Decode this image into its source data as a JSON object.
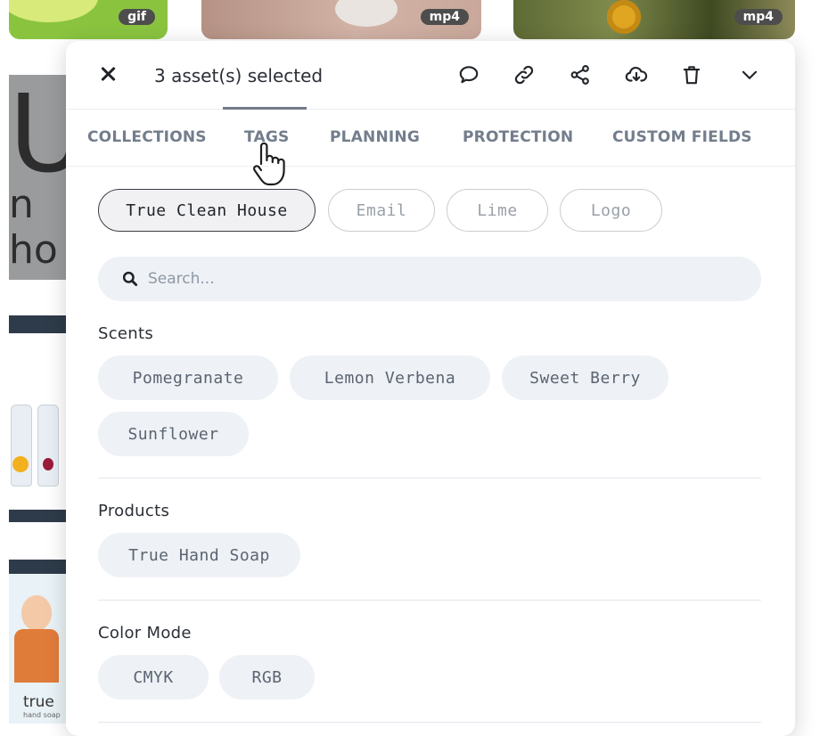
{
  "background": {
    "thumbnails": [
      {
        "format": "gif"
      },
      {
        "format": "mp4"
      },
      {
        "format": "mp4"
      }
    ],
    "grey_letter": "U",
    "grey_fragment": "n ho",
    "product_brand": "true",
    "product_sub": "hand soap"
  },
  "panel": {
    "selection_label": "3 asset(s) selected",
    "actions": {
      "comment": "comment-icon",
      "link": "link-icon",
      "share": "share-icon",
      "download": "download-cloud-icon",
      "delete": "trash-icon",
      "expand": "chevron-down-icon"
    },
    "tabs": [
      {
        "label": "COLLECTIONS"
      },
      {
        "label": "TAGS",
        "active": true
      },
      {
        "label": "PLANNING"
      },
      {
        "label": "PROTECTION"
      },
      {
        "label": "CUSTOM FIELDS"
      }
    ],
    "collections": [
      {
        "label": "True Clean House",
        "active": true
      },
      {
        "label": "Email",
        "active": false
      },
      {
        "label": "Lime",
        "active": false
      },
      {
        "label": "Logo",
        "active": false
      }
    ],
    "search": {
      "placeholder": "Search...",
      "value": ""
    },
    "groups": [
      {
        "title": "Scents",
        "tags": [
          "Pomegranate",
          "Lemon Verbena",
          "Sweet Berry",
          "Sunflower"
        ]
      },
      {
        "title": "Products",
        "tags": [
          "True Hand Soap"
        ]
      },
      {
        "title": "Color Mode",
        "tags": [
          "CMYK",
          "RGB"
        ]
      }
    ]
  },
  "colors": {
    "tag_bg": "#eef1f5",
    "tab_text": "#737d8c",
    "active_chip_border": "#3a3e44"
  }
}
